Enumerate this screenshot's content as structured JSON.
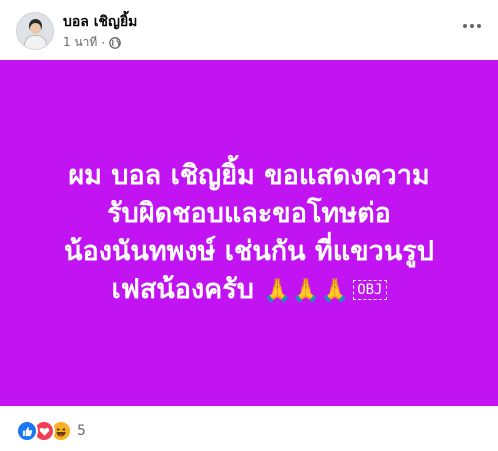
{
  "post": {
    "author": "บอล เชิญยิ้ม",
    "timestamp": "1 นาที",
    "separator": "·",
    "privacy_icon": "globe-icon",
    "background_color": "#c214f2",
    "text_lines": [
      "ผม บอล เชิญยิ้ม ขอแสดงความ",
      "รับผิดชอบและขอโทษต่อ",
      "น้องนันทพงษ์ เช่นกัน ที่แขวนรูป",
      "เฟสน้องครับ"
    ],
    "text_emoji": "🙏🙏🙏",
    "obj_placeholder": "OBJ"
  },
  "reactions": {
    "icons": [
      "like-icon",
      "love-icon",
      "haha-icon"
    ],
    "count": "5"
  },
  "colors": {
    "like": "#1877f2",
    "love": "#f33e58",
    "haha": "#f7b125",
    "meta_text": "#65676b"
  }
}
